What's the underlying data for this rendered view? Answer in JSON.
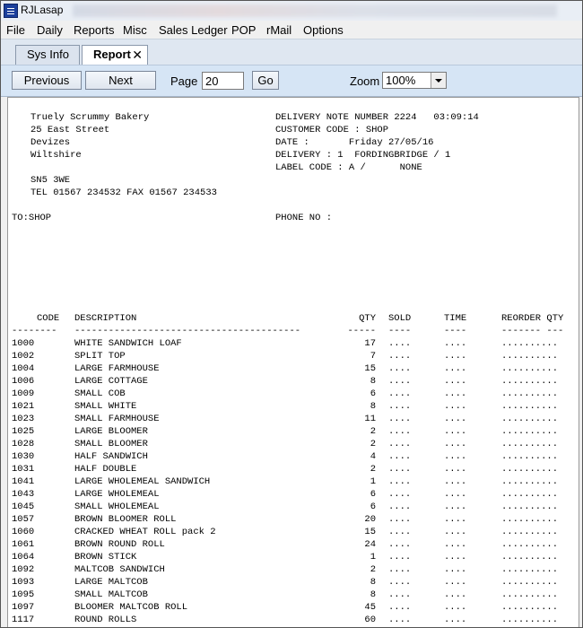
{
  "window": {
    "title": "RJLasap"
  },
  "menu": [
    "File",
    "Daily",
    "Reports",
    "Misc",
    "Sales Ledger",
    "POP",
    "rMail",
    "Options"
  ],
  "tabs": [
    {
      "label": "Sys Info"
    },
    {
      "label": "Report",
      "close": "✕"
    }
  ],
  "toolbar": {
    "previous": "Previous",
    "next": "Next",
    "page_label": "Page",
    "page_value": "20",
    "go": "Go",
    "zoom_label": "Zoom",
    "zoom_value": "100%"
  },
  "report": {
    "company": [
      "Truely Scrummy Bakery",
      "25 East Street",
      "Devizes",
      "Wiltshire"
    ],
    "postcode": "SN5 3WE",
    "tel": "TEL 01567 234532 FAX 01567 234533",
    "delivery_note": "DELIVERY NOTE NUMBER 2224   03:09:14",
    "customer_code": "CUSTOMER CODE : SHOP",
    "date": "DATE :       Friday 27/05/16",
    "delivery": "DELIVERY : 1  FORDINGBRIDGE / 1",
    "label_code": "LABEL CODE : A /      NONE",
    "to": "TO:SHOP",
    "phone": "PHONE NO :",
    "headers": {
      "code": "CODE",
      "description": "DESCRIPTION",
      "qty": "QTY",
      "sold": "SOLD",
      "time": "TIME",
      "reorder": "REORDER QTY"
    },
    "underline": {
      "code": "--------",
      "description": "----------------------------------------",
      "qty": "-----",
      "sold": "----",
      "time": "----",
      "reorder": "------- ---"
    },
    "dots": {
      "sold": "....",
      "time": "....",
      "reorder": ".........."
    },
    "rows": [
      {
        "code": "1000",
        "description": "WHITE SANDWICH LOAF",
        "qty": "17"
      },
      {
        "code": "1002",
        "description": "SPLIT TOP",
        "qty": "7"
      },
      {
        "code": "1004",
        "description": "LARGE FARMHOUSE",
        "qty": "15"
      },
      {
        "code": "1006",
        "description": "LARGE COTTAGE",
        "qty": "8"
      },
      {
        "code": "1009",
        "description": "SMALL COB",
        "qty": "6"
      },
      {
        "code": "1021",
        "description": "SMALL WHITE",
        "qty": "8"
      },
      {
        "code": "1023",
        "description": "SMALL FARMHOUSE",
        "qty": "11"
      },
      {
        "code": "1025",
        "description": "LARGE BLOOMER",
        "qty": "2"
      },
      {
        "code": "1028",
        "description": "SMALL BLOOMER",
        "qty": "2"
      },
      {
        "code": "1030",
        "description": "HALF SANDWICH",
        "qty": "4"
      },
      {
        "code": "1031",
        "description": "HALF DOUBLE",
        "qty": "2"
      },
      {
        "code": "1041",
        "description": "LARGE WHOLEMEAL SANDWICH",
        "qty": "1"
      },
      {
        "code": "1043",
        "description": "LARGE WHOLEMEAL",
        "qty": "6"
      },
      {
        "code": "1045",
        "description": "SMALL WHOLEMEAL",
        "qty": "6"
      },
      {
        "code": "1057",
        "description": "BROWN BLOOMER ROLL",
        "qty": "20"
      },
      {
        "code": "1060",
        "description": "CRACKED WHEAT ROLL pack 2",
        "qty": "15"
      },
      {
        "code": "1061",
        "description": "BROWN ROUND ROLL",
        "qty": "24"
      },
      {
        "code": "1064",
        "description": "BROWN STICK",
        "qty": "1"
      },
      {
        "code": "1092",
        "description": "MALTCOB SANDWICH",
        "qty": "2"
      },
      {
        "code": "1093",
        "description": "LARGE MALTCOB",
        "qty": "8"
      },
      {
        "code": "1095",
        "description": "SMALL MALTCOB",
        "qty": "8"
      },
      {
        "code": "1097",
        "description": "BLOOMER MALTCOB ROLL",
        "qty": "45"
      },
      {
        "code": "1117",
        "description": "ROUND ROLLS",
        "qty": "60"
      }
    ]
  }
}
